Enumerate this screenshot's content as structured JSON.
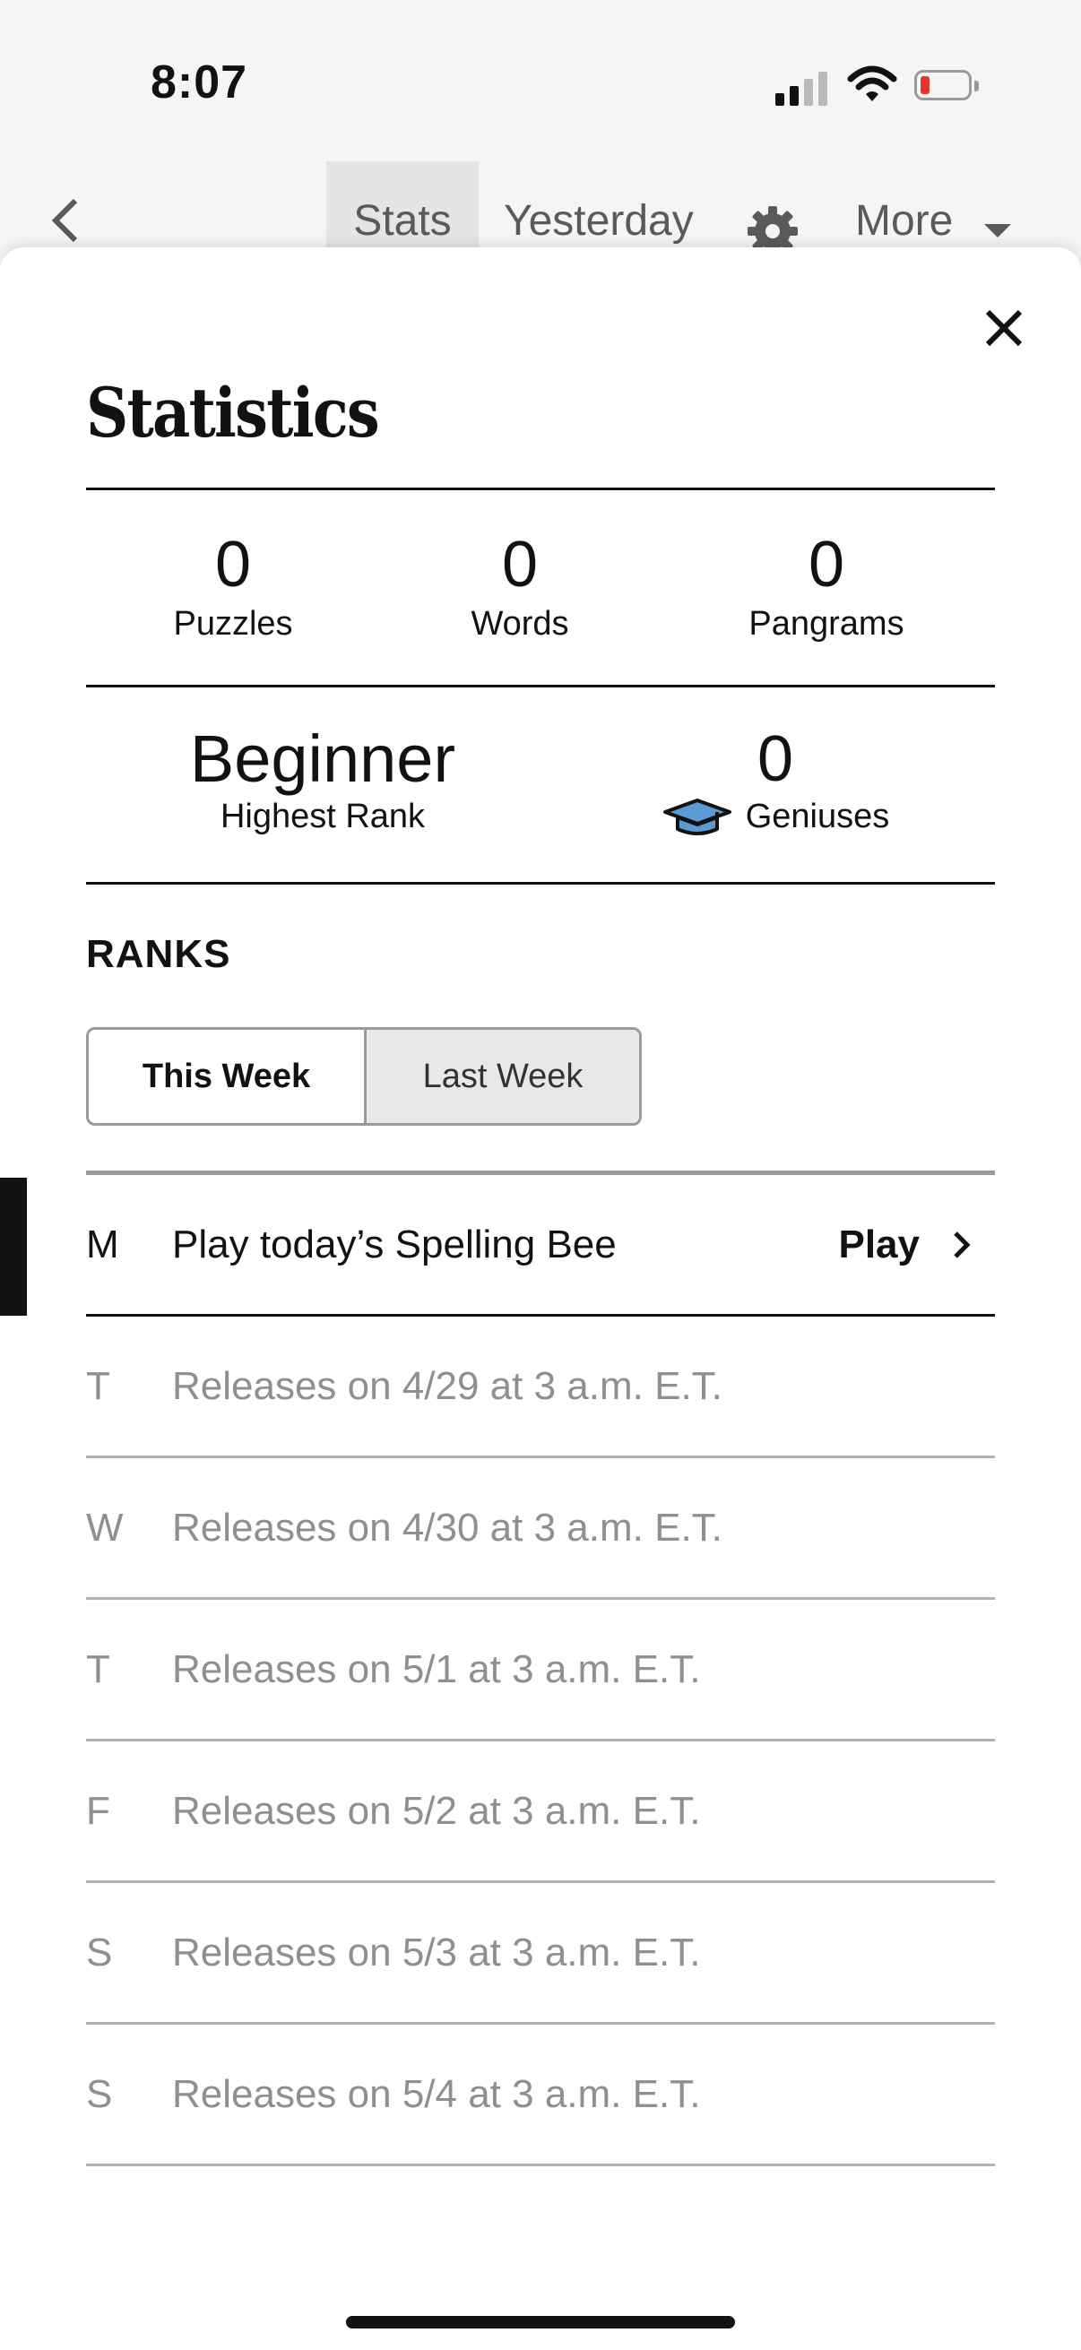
{
  "status_bar": {
    "time": "8:07"
  },
  "nav": {
    "tabs": [
      {
        "label": "Stats"
      },
      {
        "label": "Yesterday"
      }
    ],
    "more_label": "More"
  },
  "sheet": {
    "title": "Statistics",
    "stats": {
      "puzzles": {
        "value": "0",
        "label": "Puzzles"
      },
      "words": {
        "value": "0",
        "label": "Words"
      },
      "pangrams": {
        "value": "0",
        "label": "Pangrams"
      }
    },
    "highest_rank": {
      "value": "Beginner",
      "label": "Highest Rank"
    },
    "geniuses": {
      "value": "0",
      "label": "Geniuses",
      "icon": "graduation-cap-icon"
    },
    "ranks_heading": "RANKS",
    "segments": [
      {
        "label": "This Week",
        "selected": true
      },
      {
        "label": "Last Week",
        "selected": false
      }
    ],
    "week": [
      {
        "day": "M",
        "text": "Play today’s Spelling Bee",
        "action": "Play"
      },
      {
        "day": "T",
        "text": "Releases on 4/29 at 3 a.m. E.T."
      },
      {
        "day": "W",
        "text": "Releases on 4/30 at 3 a.m. E.T."
      },
      {
        "day": "T",
        "text": "Releases on 5/1 at 3 a.m. E.T."
      },
      {
        "day": "F",
        "text": "Releases on 5/2 at 3 a.m. E.T."
      },
      {
        "day": "S",
        "text": "Releases on 5/3 at 3 a.m. E.T."
      },
      {
        "day": "S",
        "text": "Releases on 5/4 at 3 a.m. E.T."
      }
    ]
  },
  "colors": {
    "battery_low": "#e8322d",
    "cap_fill": "#5b9bd5"
  }
}
